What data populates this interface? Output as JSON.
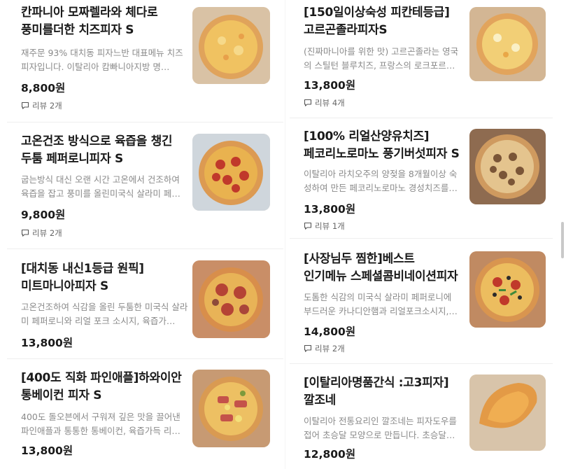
{
  "menu": {
    "left": [
      {
        "title": "칸파니아 모짜렐라와 체다로 풍미를더한 치즈피자 S",
        "desc": "재주문 93% 대치동 피자느반 대표메뉴 치즈피자입니다. 이탈리아 캄빠니아지방 명…",
        "price": "8,800원",
        "review": "리뷰 2개",
        "image": "cheese-pizza"
      },
      {
        "title": "고온건조 방식으로 육즙을 챙긴 두툼 페퍼로니피자 S",
        "desc": "굽는방식 대신 오랜 시간 고온에서 건조하여 육즙을 잡고 풍미를 올린미국식 살라미 페…",
        "price": "9,800원",
        "review": "리뷰 2개",
        "image": "pepperoni-pizza"
      },
      {
        "title": "[대치동 내신1등급 원픽] 미트마니아피자 S",
        "desc": "고온건조하여 식감을 올린 두툼한 미국식 살라미 페퍼로니와 리얼 포크 소시지, 육즙가…",
        "price": "13,800원",
        "review": "",
        "image": "meat-mania-pizza"
      },
      {
        "title": "[400도 직화 파인애플]하와이안 통베이컨 피자 S",
        "desc": "400도 돌오븐에서 구워져 깊은 맛을 끌어낸 파인애플과 통통한 통베이컨, 육즙가득 리…",
        "price": "13,800원",
        "review": "",
        "image": "hawaiian-pizza"
      }
    ],
    "right": [
      {
        "title": "[150일이상숙성 피칸테등급] 고르곤졸라피자S",
        "desc": "(진짜마니아를 위한 맛) 고르곤졸라는 영국의 스틸턴 블루치즈, 프랑스의 로크포르와…",
        "price": "13,800원",
        "review": "리뷰 4개",
        "image": "gorgonzola-pizza"
      },
      {
        "title": "[100% 리얼산양유치즈]페코리노로마노 풍기버섯피자 S",
        "desc": "이탈리아 라치오주의 양젖을 8개월이상 숙성하여 만든 페코리노로마노 경성치즈를…",
        "price": "13,800원",
        "review": "리뷰 1개",
        "image": "mushroom-pizza"
      },
      {
        "title": "[사장님두 찜한]베스트 인기메뉴 스페셜콤비네이션피자",
        "desc": "도톰한 식감의 미국식 살라미 페퍼로니에 부드러운 카나디안햄과 리얼포크소시지, 지…",
        "price": "14,800원",
        "review": "리뷰 2개",
        "image": "combination-pizza"
      },
      {
        "title": "[이탈리아명품간식 :고3피자] 깔조네",
        "desc": "이탈리아 전통요리인 깔조네는 피자도우를 접어 초승달 모양으로 만듭니다. 초승달은…",
        "price": "12,800원",
        "review": "",
        "image": "calzone"
      }
    ]
  },
  "icons": {
    "review": "speech-bubble-icon"
  },
  "colors": {
    "crust": "#e3a45d",
    "cheese": "#f2c75c",
    "pepperoni": "#c0392b",
    "background": "#ffffff"
  }
}
